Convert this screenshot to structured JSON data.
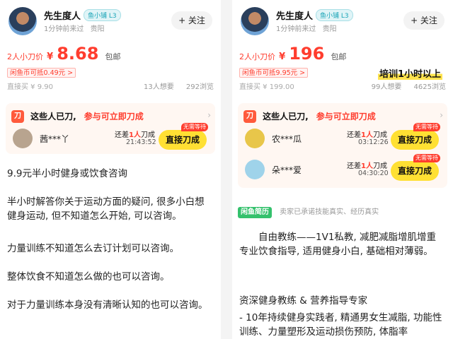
{
  "left": {
    "seller": {
      "name": "先生度人",
      "level": "鱼小铺 L3",
      "last_seen": "1分钟前来过",
      "location": "贵阳"
    },
    "follow_label": "+ 关注",
    "price_label": "2人小刀价",
    "currency": "¥",
    "price": "8.68",
    "price_suffix": "包邮",
    "coupon": "闲鱼币可抵0.49元 >",
    "direct_buy": "直接买 ¥ 9.90",
    "wants": "13人想要",
    "views": "292浏览",
    "cut": {
      "icon": "刀",
      "title": "这些人已刀,",
      "subtitle": "参与可立即刀成",
      "rows": [
        {
          "name": "茜***丫",
          "remain_prefix": "还差",
          "remain_count": "1人",
          "remain_suffix": "刀成",
          "time": "21:43:52",
          "button": "直接刀成",
          "tag": "无需等待"
        }
      ]
    },
    "desc": [
      "9.9元半小时健身或饮食咨询",
      "半小时解答你关于运动方面的疑问, 很多小白想健身运动, 但不知道怎么开始, 可以咨询。",
      "力量训练不知道怎么去订计划可以咨询。",
      "整体饮食不知道怎么做的也可以咨询。",
      "对于力量训练本身没有清晰认知的也可以咨询。"
    ]
  },
  "right": {
    "seller": {
      "name": "先生度人",
      "level": "鱼小铺 L3",
      "last_seen": "1分钟前来过",
      "location": "贵阳"
    },
    "follow_label": "+ 关注",
    "price_label": "2人小刀价",
    "currency": "¥",
    "price": "196",
    "price_suffix": "包邮",
    "coupon": "闲鱼币可抵9.95元 >",
    "highlight": "培训1小时以上",
    "direct_buy": "直接买 ¥ 199.00",
    "wants": "99人想要",
    "views": "4625浏览",
    "cut": {
      "icon": "刀",
      "title": "这些人已刀,",
      "subtitle": "参与可立即刀成",
      "rows": [
        {
          "name": "农***瓜",
          "remain_prefix": "还差",
          "remain_count": "1人",
          "remain_suffix": "刀成",
          "time": "03:12:26",
          "button": "直接刀成",
          "tag": "无需等待"
        },
        {
          "name": "朵***爱",
          "remain_prefix": "还差",
          "remain_count": "1人",
          "remain_suffix": "刀成",
          "time": "04:30:20",
          "button": "直接刀成",
          "tag": "无需等待"
        }
      ]
    },
    "record_badge": "闲鱼简历",
    "record_text": "卖家已承诺技能真实、经历真实",
    "desc": [
      "自由教练——1V1私教, 减肥减脂增肌增重专业饮食指导, 适用健身小白, 基础相对薄弱。",
      "资深健身教练 & 营养指导专家",
      "- 10年持续健身实践者, 精通男女生减脂, 功能性训练、力量塑形及运动损伤预防, 体脂率"
    ]
  },
  "colors": {
    "accent": "#ff3d2e",
    "button_yellow": "#ffe033",
    "record_green": "#34c16c"
  }
}
